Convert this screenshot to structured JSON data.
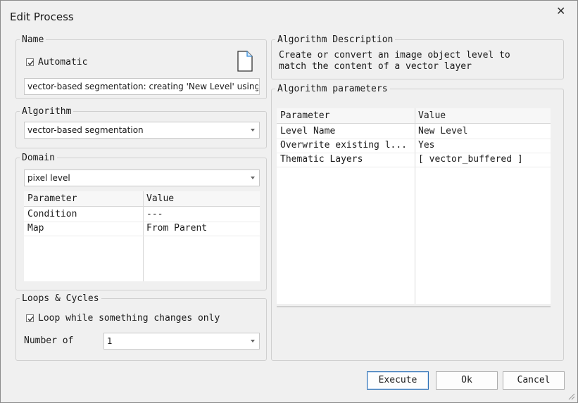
{
  "window": {
    "title": "Edit Process",
    "close_glyph": "✕"
  },
  "name_group": {
    "legend": "Name",
    "automatic_label": "Automatic",
    "automatic_checked": true,
    "name_value": "vector-based segmentation: creating 'New Level' using ve",
    "icon": "document-icon"
  },
  "algorithm_group": {
    "legend": "Algorithm",
    "selected": "vector-based segmentation"
  },
  "domain_group": {
    "legend": "Domain",
    "selected": "pixel level",
    "headers": [
      "Parameter",
      "Value"
    ],
    "rows": [
      {
        "param": "Condition",
        "value": "---"
      },
      {
        "param": "Map",
        "value": "From Parent"
      }
    ]
  },
  "loops_group": {
    "legend": "Loops & Cycles",
    "loop_label": "Loop while something changes only",
    "loop_checked": true,
    "number_label": "Number of",
    "number_value": "1"
  },
  "description_group": {
    "legend": "Algorithm Description",
    "text_line1": "Create or convert an image object level to",
    "text_line2": "match the content of a vector layer"
  },
  "parameters_group": {
    "legend": "Algorithm parameters",
    "headers": [
      "Parameter",
      "Value"
    ],
    "rows": [
      {
        "param": "Level Name",
        "value": "New Level"
      },
      {
        "param": "Overwrite existing l...",
        "value": "Yes"
      },
      {
        "param": "Thematic Layers",
        "value": "[ vector_buffered ]"
      }
    ]
  },
  "buttons": {
    "execute": "Execute",
    "ok": "Ok",
    "cancel": "Cancel"
  }
}
